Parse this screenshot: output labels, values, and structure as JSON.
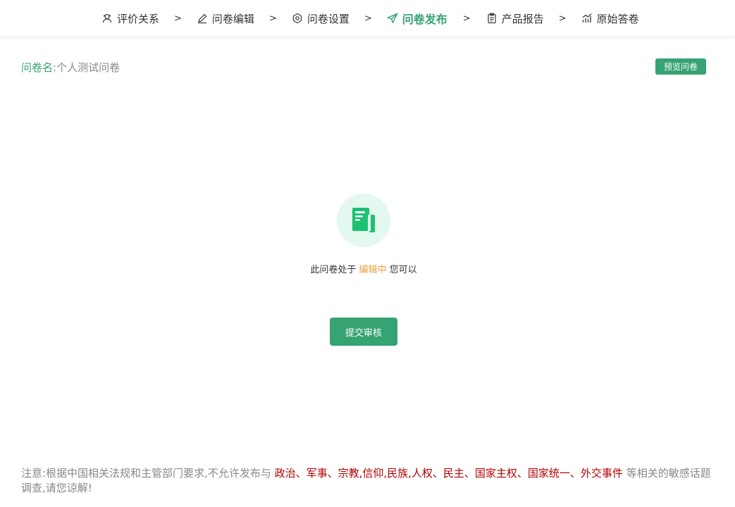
{
  "steps": [
    {
      "label": "评价关系",
      "icon": "users-icon"
    },
    {
      "label": "问卷编辑",
      "icon": "pencil-icon"
    },
    {
      "label": "问卷设置",
      "icon": "settings-icon"
    },
    {
      "label": "问卷发布",
      "icon": "send-icon",
      "active": true
    },
    {
      "label": "产品报告",
      "icon": "clipboard-icon"
    },
    {
      "label": "原始答卷",
      "icon": "chart-icon"
    }
  ],
  "separator": ">",
  "questionnaire": {
    "name_label": "问卷名:",
    "name_value": "个人测试问卷"
  },
  "preview_button": "预览问卷",
  "status": {
    "prefix": "此问卷处于",
    "state": "编辑中",
    "suffix": "您可以"
  },
  "submit_button": "提交审核",
  "notice": {
    "prefix": "注意:根据中国相关法规和主管部门要求,不允许发布与",
    "topics": "政治、军事、宗教,信仰,民族,人权、民主、国家主权、国家统一、外交事件",
    "suffix": "等相关的敏感话题调查,请您谅解!"
  },
  "colors": {
    "accent": "#35a372",
    "status_highlight": "#e6a23c",
    "warning_red": "#b30000",
    "icon_bg": "#e3f8ee",
    "icon_fg": "#1dc172"
  }
}
